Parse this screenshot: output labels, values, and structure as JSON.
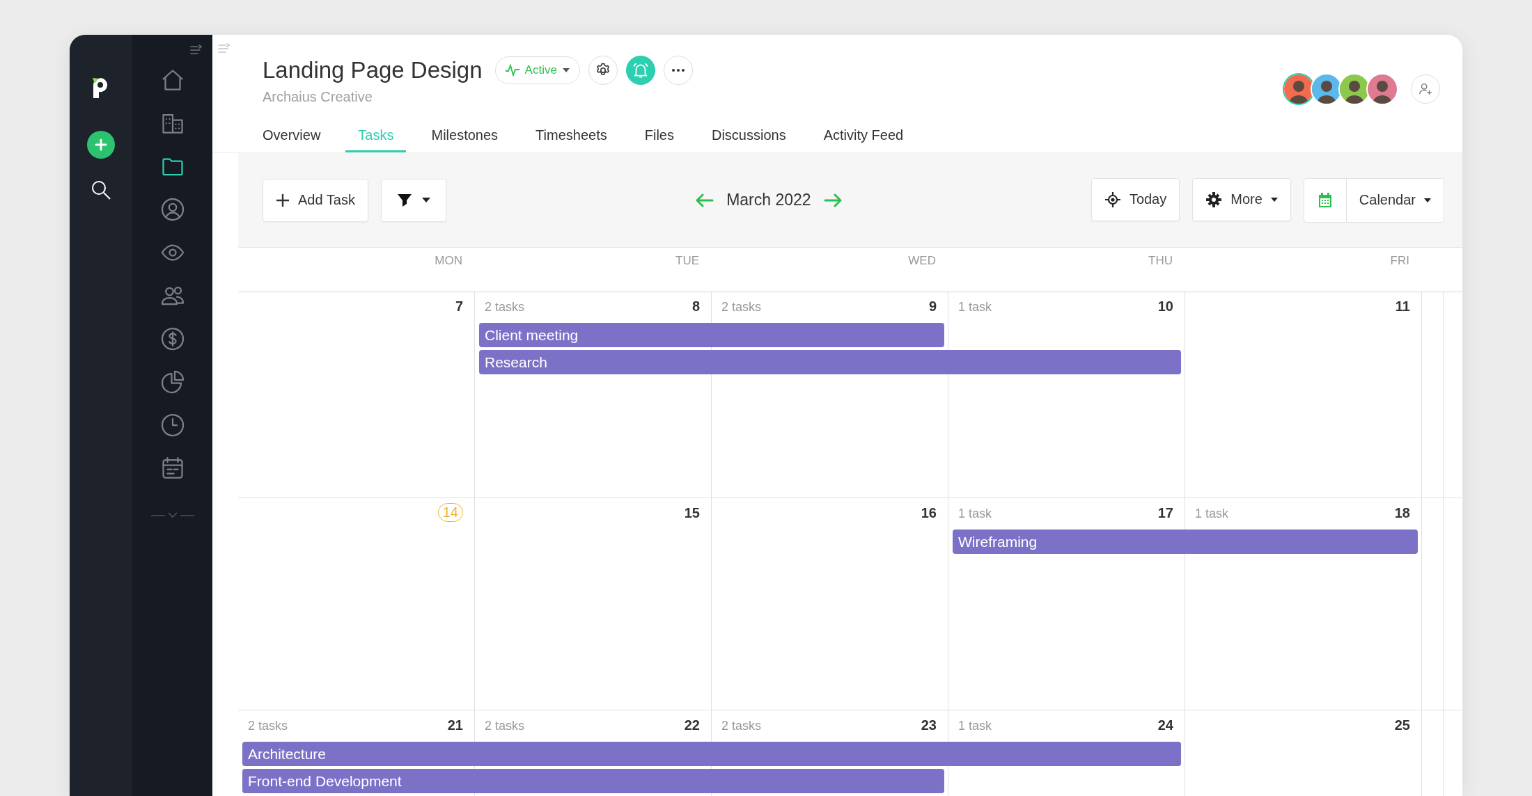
{
  "project": {
    "title": "Landing Page Design",
    "client": "Archaius Creative",
    "status": "Active",
    "notifications_on": true
  },
  "members": [
    {
      "color": "#f26b4f",
      "selected": true
    },
    {
      "color": "#5bb8ea",
      "selected": false
    },
    {
      "color": "#8cc84b",
      "selected": false
    },
    {
      "color": "#e07a92",
      "selected": false
    }
  ],
  "nav": [
    {
      "kind": "home",
      "selected": false
    },
    {
      "kind": "building",
      "selected": false
    },
    {
      "kind": "folder",
      "selected": true
    },
    {
      "kind": "user",
      "selected": false
    },
    {
      "kind": "eye",
      "selected": false
    },
    {
      "kind": "people",
      "selected": false
    },
    {
      "kind": "dollar",
      "selected": false
    },
    {
      "kind": "pie",
      "selected": false
    },
    {
      "kind": "clock",
      "selected": false
    },
    {
      "kind": "calendar",
      "selected": false
    }
  ],
  "tabs": [
    {
      "label": "Overview",
      "selected": false
    },
    {
      "label": "Tasks",
      "selected": true
    },
    {
      "label": "Milestones",
      "selected": false
    },
    {
      "label": "Timesheets",
      "selected": false
    },
    {
      "label": "Files",
      "selected": false
    },
    {
      "label": "Discussions",
      "selected": false
    },
    {
      "label": "Activity Feed",
      "selected": false
    }
  ],
  "toolbar": {
    "add_label": "Add Task",
    "month": "March 2022",
    "today_label": "Today",
    "more_label": "More",
    "view_label": "Calendar"
  },
  "weekdays": [
    "MON",
    "TUE",
    "WED",
    "THU",
    "FRI"
  ],
  "weeks": [
    {
      "days": [
        {
          "number": "7",
          "today": false
        },
        {
          "number": "8",
          "count": "2 tasks",
          "today": false
        },
        {
          "number": "9",
          "count": "2 tasks",
          "today": false
        },
        {
          "number": "10",
          "count": "1 task",
          "today": false
        },
        {
          "number": "11",
          "today": false
        }
      ],
      "events": [
        {
          "label": "Client meeting",
          "days": [
            false,
            true,
            true,
            false,
            false
          ]
        },
        {
          "label": "Research",
          "days": [
            false,
            true,
            true,
            true,
            false
          ]
        }
      ]
    },
    {
      "days": [
        {
          "number": "14",
          "today": true
        },
        {
          "number": "15",
          "today": false
        },
        {
          "number": "16",
          "today": false
        },
        {
          "number": "17",
          "count": "1 task",
          "today": false
        },
        {
          "number": "18",
          "count": "1 task",
          "today": false
        }
      ],
      "events": [
        {
          "label": "Wireframing",
          "days": [
            false,
            false,
            false,
            true,
            true
          ]
        }
      ]
    },
    {
      "days": [
        {
          "number": "21",
          "count": "2 tasks",
          "today": false
        },
        {
          "number": "22",
          "count": "2 tasks",
          "today": false
        },
        {
          "number": "23",
          "count": "2 tasks",
          "today": false
        },
        {
          "number": "24",
          "count": "1 task",
          "today": false
        },
        {
          "number": "25",
          "today": false
        }
      ],
      "events": [
        {
          "label": "Architecture",
          "days": [
            true,
            true,
            true,
            true,
            false
          ]
        },
        {
          "label": "Front-end Development",
          "days": [
            true,
            true,
            true,
            false,
            false
          ]
        }
      ]
    }
  ]
}
